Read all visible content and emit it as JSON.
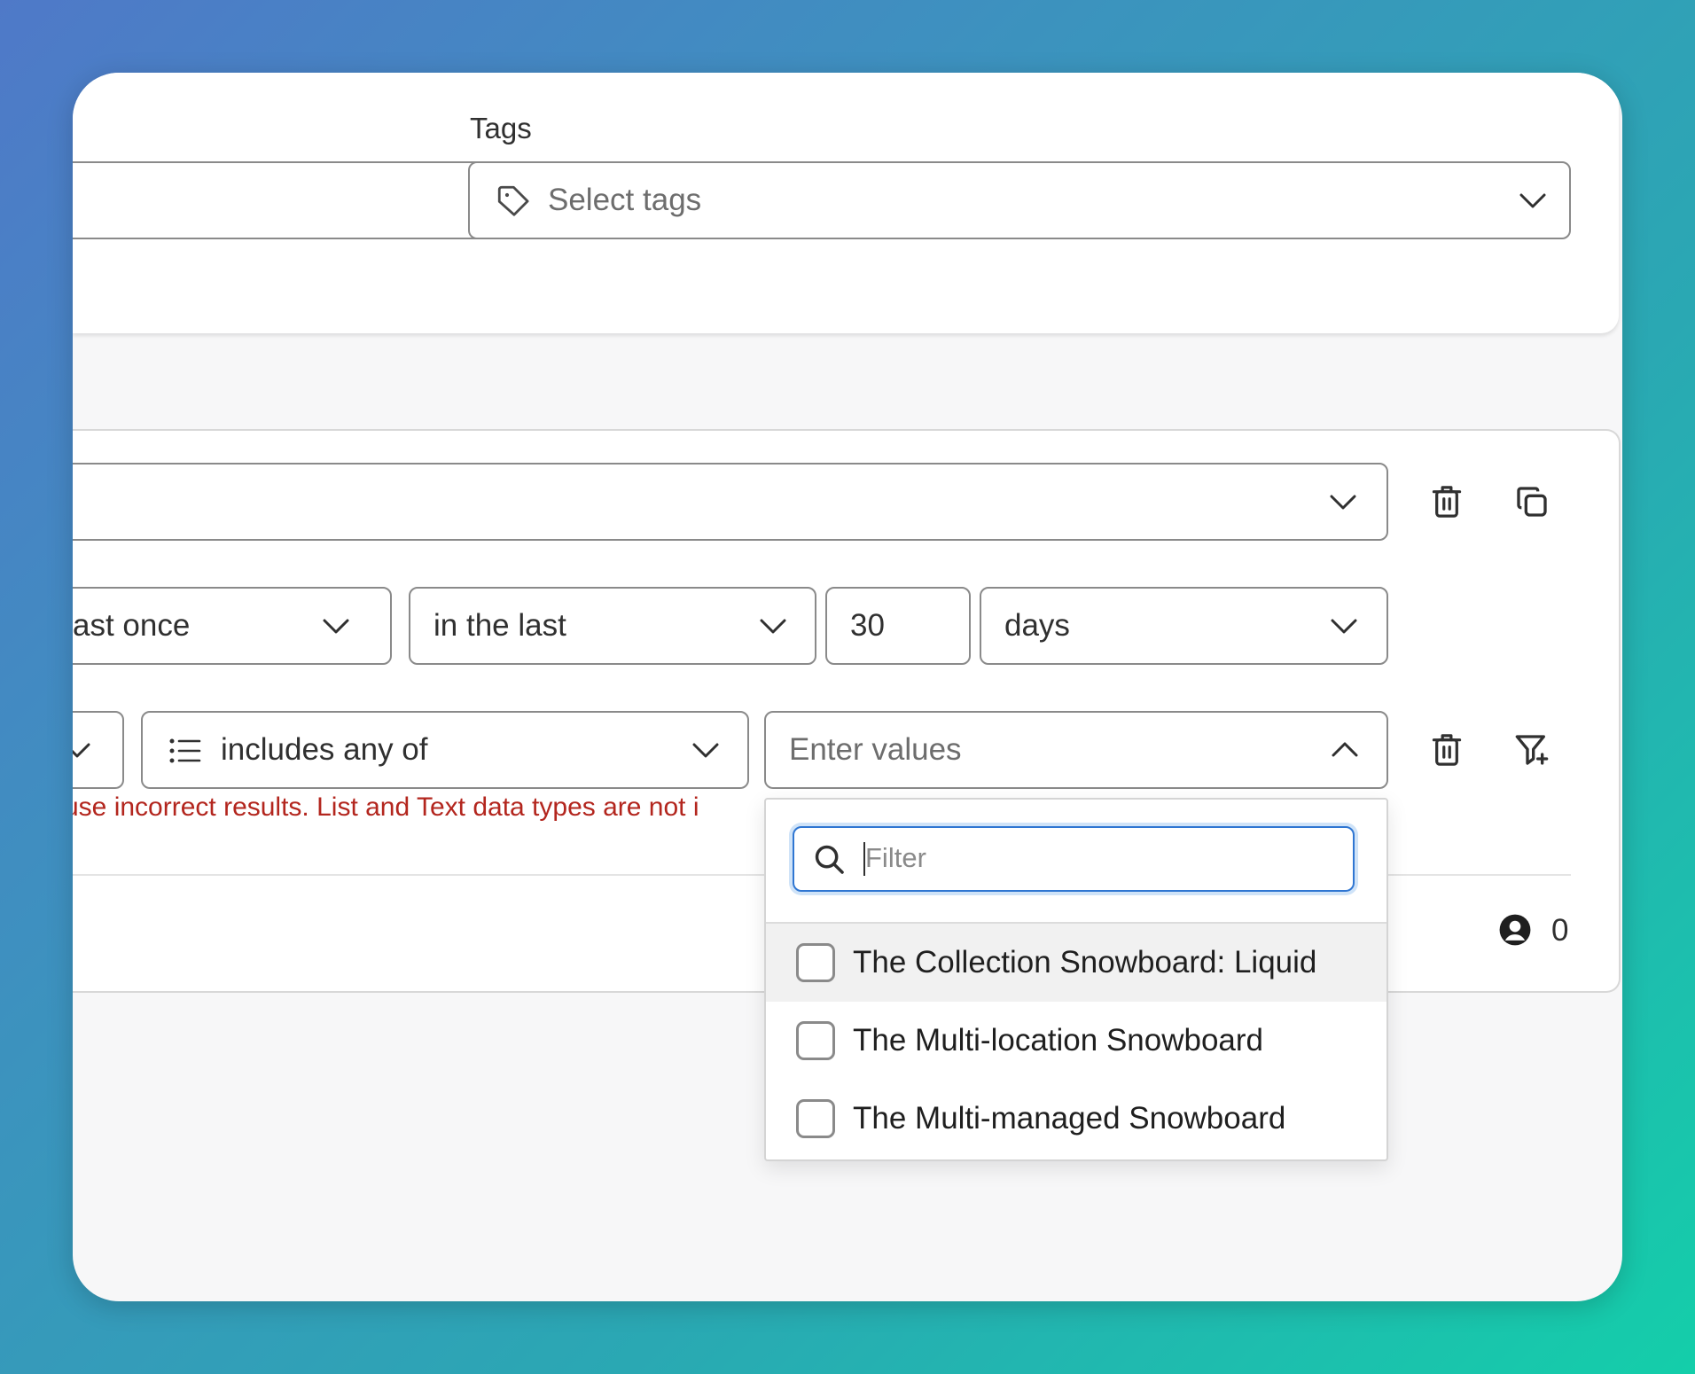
{
  "tags": {
    "label": "Tags",
    "placeholder": "Select tags"
  },
  "condition_row_1": {
    "frequency_value": "ast once",
    "period_value": "in the last",
    "number_value": "30",
    "unit_value": "days"
  },
  "condition_row_2": {
    "operator_value": "includes any of",
    "values_placeholder": "Enter values",
    "error_text": "use incorrect results. List and Text data types are not i"
  },
  "dropdown": {
    "filter_placeholder": "Filter",
    "options": [
      {
        "label": "The Collection Snowboard: Liquid",
        "checked": false
      },
      {
        "label": "The Multi-location Snowboard",
        "checked": false
      },
      {
        "label": "The Multi-managed Snowboard",
        "checked": false
      }
    ]
  },
  "footer": {
    "customer_count": "0"
  },
  "colors": {
    "error": "#b3261e",
    "focus_ring": "#2f76d2"
  }
}
